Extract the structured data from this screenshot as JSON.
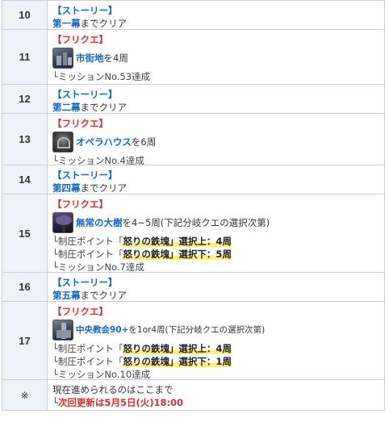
{
  "rows": [
    {
      "num": "10",
      "tag": "【ストーリー】",
      "main": "第一幕",
      "suffix": "までクリア"
    },
    {
      "num": "11",
      "tag": "【フリクエ】",
      "main": "市街地",
      "suffix": "を4周",
      "sub1": "└ミッションNo.53達成",
      "thumb": "city-thumbnail"
    },
    {
      "num": "12",
      "tag": "【ストーリー】",
      "main": "第二幕",
      "suffix": "までクリア"
    },
    {
      "num": "13",
      "tag": "【フリクエ】",
      "main": "オペラハウス",
      "suffix": "を6周",
      "sub1": "└ミッションNo.4達成",
      "thumb": "opera-house-thumbnail"
    },
    {
      "num": "14",
      "tag": "【ストーリー】",
      "main": "第四幕",
      "suffix": "までクリア"
    },
    {
      "num": "15",
      "tag": "【フリクエ】",
      "main": "無常の大樹",
      "suffix": "を4~5周(下記分岐クエの選択次第)",
      "lines": [
        {
          "pre": "└制圧ポイント「",
          "hl": "怒りの鉄塊」選択上：4周"
        },
        {
          "pre": "└制圧ポイント「",
          "hl": "怒りの鉄塊」選択下：5周"
        }
      ],
      "sub1": "└ミッションNo.7達成",
      "thumb": "great-tree-thumbnail"
    },
    {
      "num": "16",
      "tag": "【ストーリー】",
      "main": "第五幕",
      "suffix": "までクリア"
    },
    {
      "num": "17",
      "tag": "【フリクエ】",
      "main": "中央教会90+",
      "suffix": "を1or4周(下記分岐クエの選択次第)",
      "lines": [
        {
          "pre": "└制圧ポイント「",
          "hl": "怒りの鉄塊」選択上：4周"
        },
        {
          "pre": "└制圧ポイント「",
          "hl": "怒りの鉄塊」選択下：1周"
        }
      ],
      "sub1": "└ミッションNo.10達成",
      "thumb": "central-church-thumbnail"
    },
    {
      "num": "※",
      "note": "現在進められるのはここまで",
      "update_pre": "└",
      "update": "次回更新は5月5日(火)18:00"
    }
  ],
  "colors": {
    "story": "#1565c0",
    "quest": "#d32f2f",
    "highlight": "#fff176",
    "num_bg": "#eef3f9"
  }
}
